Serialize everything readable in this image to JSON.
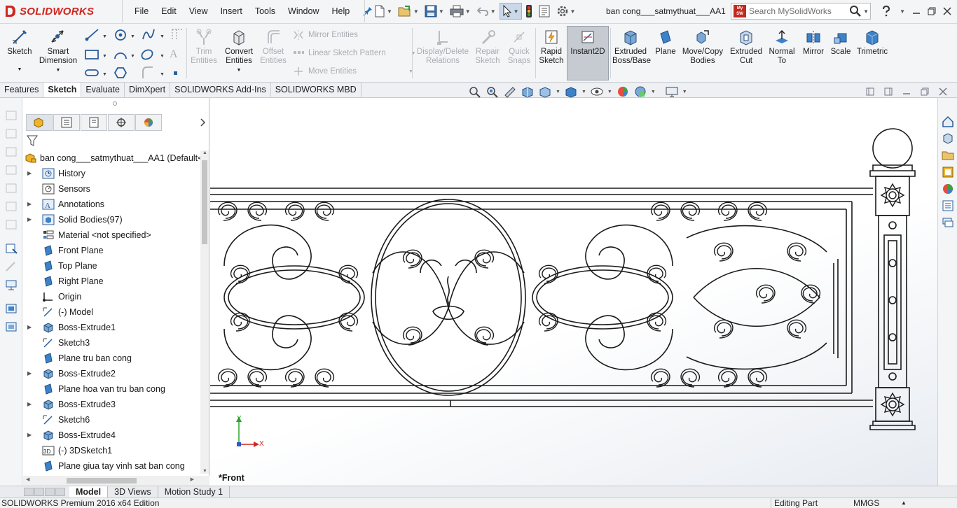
{
  "app": {
    "brand": "SOLIDWORKS",
    "document_title": "ban cong___satmythuat___AA1",
    "search_placeholder": "Search MySolidWorks"
  },
  "menu": [
    "File",
    "Edit",
    "View",
    "Insert",
    "Tools",
    "Window",
    "Help"
  ],
  "ribbon": {
    "sketch": "Sketch",
    "smart_dimension": [
      "Smart",
      "Dimension"
    ],
    "trim_entities": [
      "Trim",
      "Entities"
    ],
    "convert_entities": [
      "Convert",
      "Entities"
    ],
    "offset_entities": [
      "Offset",
      "Entities"
    ],
    "mirror_entities": "Mirror Entities",
    "linear_sketch_pattern": "Linear Sketch Pattern",
    "move_entities": "Move Entities",
    "display_delete_relations": [
      "Display/Delete",
      "Relations"
    ],
    "repair_sketch": [
      "Repair",
      "Sketch"
    ],
    "quick_snaps": [
      "Quick",
      "Snaps"
    ],
    "rapid_sketch": [
      "Rapid",
      "Sketch"
    ],
    "instant2d": "Instant2D",
    "extruded_boss_base": [
      "Extruded",
      "Boss/Base"
    ],
    "plane": "Plane",
    "move_copy_bodies": [
      "Move/Copy",
      "Bodies"
    ],
    "extruded_cut": [
      "Extruded",
      "Cut"
    ],
    "normal_to": [
      "Normal",
      "To"
    ],
    "mirror": "Mirror",
    "scale": "Scale",
    "trimetric": "Trimetric"
  },
  "command_tabs": [
    {
      "label": "Features",
      "active": false
    },
    {
      "label": "Sketch",
      "active": true
    },
    {
      "label": "Evaluate",
      "active": false
    },
    {
      "label": "DimXpert",
      "active": false
    },
    {
      "label": "SOLIDWORKS Add-Ins",
      "active": false
    },
    {
      "label": "SOLIDWORKS MBD",
      "active": false
    }
  ],
  "feature_tree": {
    "root": "ban cong___satmythuat___AA1  (Default<",
    "items": [
      {
        "label": "History",
        "icon": "history-icon",
        "expandable": true
      },
      {
        "label": "Sensors",
        "icon": "sensors-icon",
        "expandable": false
      },
      {
        "label": "Annotations",
        "icon": "annotations-icon",
        "expandable": true
      },
      {
        "label": "Solid Bodies(97)",
        "icon": "solid-bodies-icon",
        "expandable": true
      },
      {
        "label": "Material <not specified>",
        "icon": "material-icon",
        "expandable": false
      },
      {
        "label": "Front Plane",
        "icon": "plane-icon",
        "expandable": false
      },
      {
        "label": "Top Plane",
        "icon": "plane-icon",
        "expandable": false
      },
      {
        "label": "Right Plane",
        "icon": "plane-icon",
        "expandable": false
      },
      {
        "label": "Origin",
        "icon": "origin-icon",
        "expandable": false
      },
      {
        "label": "(-) Model",
        "icon": "sketch-icon",
        "expandable": false
      },
      {
        "label": "Boss-Extrude1",
        "icon": "extrude-icon",
        "expandable": true
      },
      {
        "label": "Sketch3",
        "icon": "sketch-icon",
        "expandable": false
      },
      {
        "label": "Plane tru ban cong",
        "icon": "plane-icon",
        "expandable": false
      },
      {
        "label": "Boss-Extrude2",
        "icon": "extrude-icon",
        "expandable": true
      },
      {
        "label": "Plane hoa van tru ban cong",
        "icon": "plane-icon",
        "expandable": false
      },
      {
        "label": "Boss-Extrude3",
        "icon": "extrude-icon",
        "expandable": true
      },
      {
        "label": "Sketch6",
        "icon": "sketch-icon",
        "expandable": false
      },
      {
        "label": "Boss-Extrude4",
        "icon": "extrude-icon",
        "expandable": true
      },
      {
        "label": "(-) 3DSketch1",
        "icon": "3dsketch-icon",
        "expandable": false
      },
      {
        "label": "Plane giua tay vinh sat ban cong",
        "icon": "plane-icon",
        "expandable": false
      }
    ]
  },
  "viewport": {
    "view_name": "*Front",
    "axis_x": "X",
    "axis_y": "Y"
  },
  "bottom_tabs": [
    {
      "label": "Model",
      "active": true
    },
    {
      "label": "3D Views",
      "active": false
    },
    {
      "label": "Motion Study 1",
      "active": false
    }
  ],
  "status": {
    "product": "SOLIDWORKS Premium 2016 x64 Edition",
    "mode": "Editing Part",
    "units": "MMGS"
  },
  "colors": {
    "brand_red": "#d2261f",
    "accent_blue": "#1a6fc9",
    "ribbon_bg": "#f4f5f7"
  }
}
